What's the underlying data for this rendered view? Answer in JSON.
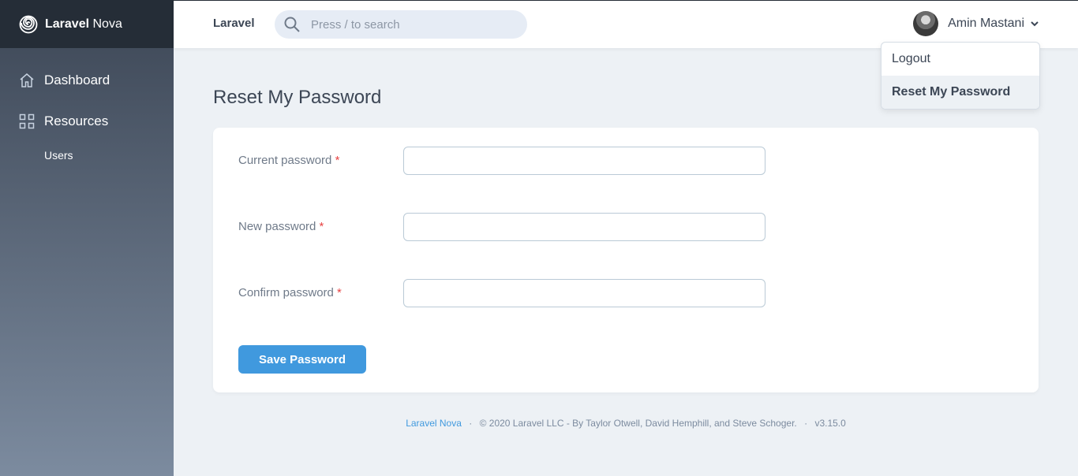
{
  "brand": {
    "bold": "Laravel",
    "light": "Nova"
  },
  "sidebar": {
    "dashboard": "Dashboard",
    "resources": "Resources",
    "users": "Users"
  },
  "header": {
    "app_name": "Laravel",
    "search_placeholder": "Press / to search",
    "user_name": "Amin Mastani"
  },
  "dropdown": {
    "logout": "Logout",
    "reset": "Reset My Password"
  },
  "page": {
    "title": "Reset My Password",
    "fields": [
      {
        "label": "Current password",
        "required": "*",
        "value": ""
      },
      {
        "label": "New password",
        "required": "*",
        "value": ""
      },
      {
        "label": "Confirm password",
        "required": "*",
        "value": ""
      }
    ],
    "save_label": "Save Password"
  },
  "footer": {
    "link": "Laravel Nova",
    "copyright": "© 2020 Laravel LLC - By Taylor Otwell, David Hemphill, and Steve Schoger.",
    "version": "v3.15.0",
    "separator": "·"
  },
  "colors": {
    "accent": "#4099de",
    "sidebar_dark": "#252d37",
    "required": "#e74444"
  }
}
